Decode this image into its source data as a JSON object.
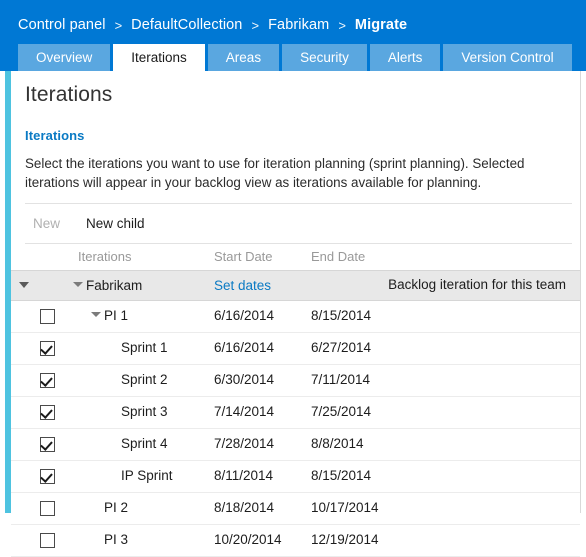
{
  "header": {
    "breadcrumb": [
      {
        "label": "Control panel",
        "current": false
      },
      {
        "label": "DefaultCollection",
        "current": false
      },
      {
        "label": "Fabrikam",
        "current": false
      },
      {
        "label": "Migrate",
        "current": true
      }
    ],
    "separator": ">",
    "background_color": "#0078d4"
  },
  "tabs": [
    {
      "label": "Overview",
      "active": false
    },
    {
      "label": "Iterations",
      "active": true
    },
    {
      "label": "Areas",
      "active": false
    },
    {
      "label": "Security",
      "active": false
    },
    {
      "label": "Alerts",
      "active": false
    },
    {
      "label": "Version Control",
      "active": false
    }
  ],
  "page": {
    "title": "Iterations",
    "section_title": "Iterations",
    "description": "Select the iterations you want to use for iteration planning (sprint planning). Selected iterations will appear in your backlog view as iterations available for planning.",
    "accent_color": "#0a7ac4",
    "strip_color": "#4ec3e0"
  },
  "toolbar": {
    "new_label": "New",
    "new_enabled": false,
    "new_child_label": "New child",
    "new_child_enabled": true
  },
  "grid": {
    "columns": {
      "iterations": "Iterations",
      "start_date": "Start Date",
      "end_date": "End Date"
    },
    "rows": [
      {
        "name": "Fabrikam",
        "level": 0,
        "root": true,
        "expanded": true,
        "has_expander": true,
        "has_checkbox": false,
        "start_date": "Set dates",
        "start_is_link": true,
        "end_date": "",
        "note": "Backlog iteration for this team"
      },
      {
        "name": "PI 1",
        "level": 1,
        "root": false,
        "expanded": true,
        "has_expander": true,
        "has_checkbox": true,
        "checked": false,
        "start_date": "6/16/2014",
        "start_is_link": false,
        "end_date": "8/15/2014",
        "note": ""
      },
      {
        "name": "Sprint 1",
        "level": 2,
        "root": false,
        "has_expander": false,
        "has_checkbox": true,
        "checked": true,
        "start_date": "6/16/2014",
        "start_is_link": false,
        "end_date": "6/27/2014",
        "note": ""
      },
      {
        "name": "Sprint 2",
        "level": 2,
        "root": false,
        "has_expander": false,
        "has_checkbox": true,
        "checked": true,
        "start_date": "6/30/2014",
        "start_is_link": false,
        "end_date": "7/11/2014",
        "note": ""
      },
      {
        "name": "Sprint 3",
        "level": 2,
        "root": false,
        "has_expander": false,
        "has_checkbox": true,
        "checked": true,
        "start_date": "7/14/2014",
        "start_is_link": false,
        "end_date": "7/25/2014",
        "note": ""
      },
      {
        "name": "Sprint 4",
        "level": 2,
        "root": false,
        "has_expander": false,
        "has_checkbox": true,
        "checked": true,
        "start_date": "7/28/2014",
        "start_is_link": false,
        "end_date": "8/8/2014",
        "note": ""
      },
      {
        "name": "IP Sprint",
        "level": 2,
        "root": false,
        "has_expander": false,
        "has_checkbox": true,
        "checked": true,
        "start_date": "8/11/2014",
        "start_is_link": false,
        "end_date": "8/15/2014",
        "note": ""
      },
      {
        "name": "PI 2",
        "level": 1,
        "root": false,
        "has_expander": false,
        "has_checkbox": true,
        "checked": false,
        "start_date": "8/18/2014",
        "start_is_link": false,
        "end_date": "10/17/2014",
        "note": ""
      },
      {
        "name": "PI 3",
        "level": 1,
        "root": false,
        "has_expander": false,
        "has_checkbox": true,
        "checked": false,
        "start_date": "10/20/2014",
        "start_is_link": false,
        "end_date": "12/19/2014",
        "note": ""
      }
    ]
  }
}
